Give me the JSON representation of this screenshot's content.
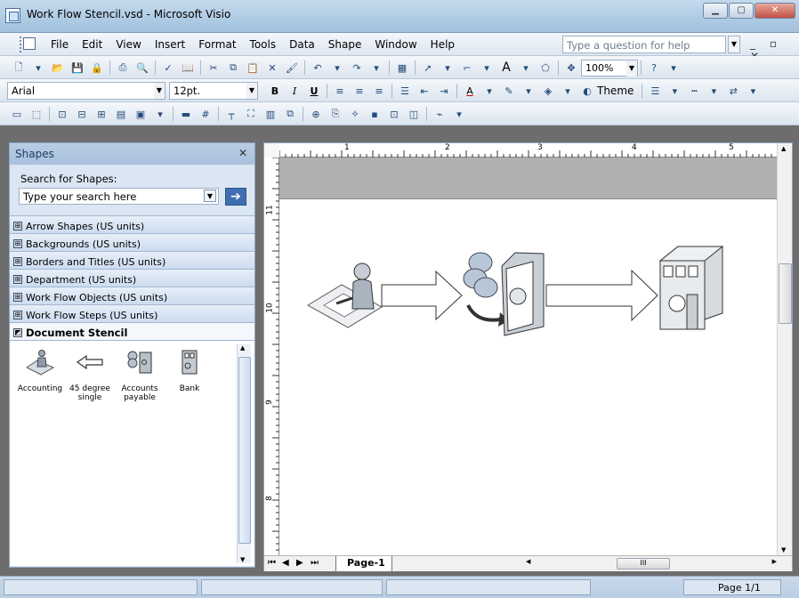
{
  "window": {
    "title": "Work Flow Stencil.vsd - Microsoft Visio"
  },
  "menu": {
    "items": [
      "File",
      "Edit",
      "View",
      "Insert",
      "Format",
      "Tools",
      "Data",
      "Shape",
      "Window",
      "Help"
    ],
    "help_placeholder": "Type a question for help"
  },
  "toolbar": {
    "zoom": "100%",
    "font": "Arial",
    "font_size": "12pt.",
    "theme_label": "Theme"
  },
  "shapes_panel": {
    "title": "Shapes",
    "search_label": "Search for Shapes:",
    "search_placeholder": "Type your search here",
    "stencils": [
      "Arrow Shapes (US units)",
      "Backgrounds (US units)",
      "Borders and Titles (US units)",
      "Department (US units)",
      "Work Flow Objects (US units)",
      "Work Flow Steps (US units)",
      "Document Stencil"
    ],
    "masters": [
      {
        "label": "Accounting",
        "icon": "accounting-icon"
      },
      {
        "label": "45 degree single",
        "icon": "arrow-left-icon"
      },
      {
        "label": "Accounts payable",
        "icon": "accounts-payable-icon"
      },
      {
        "label": "Bank",
        "icon": "bank-icon"
      }
    ]
  },
  "ruler": {
    "h_ticks": [
      "1",
      "2",
      "3",
      "4",
      "5"
    ],
    "v_ticks": [
      "11",
      "10",
      "9",
      "8"
    ]
  },
  "page_tab": "Page-1",
  "status": {
    "page": "Page 1/1"
  }
}
